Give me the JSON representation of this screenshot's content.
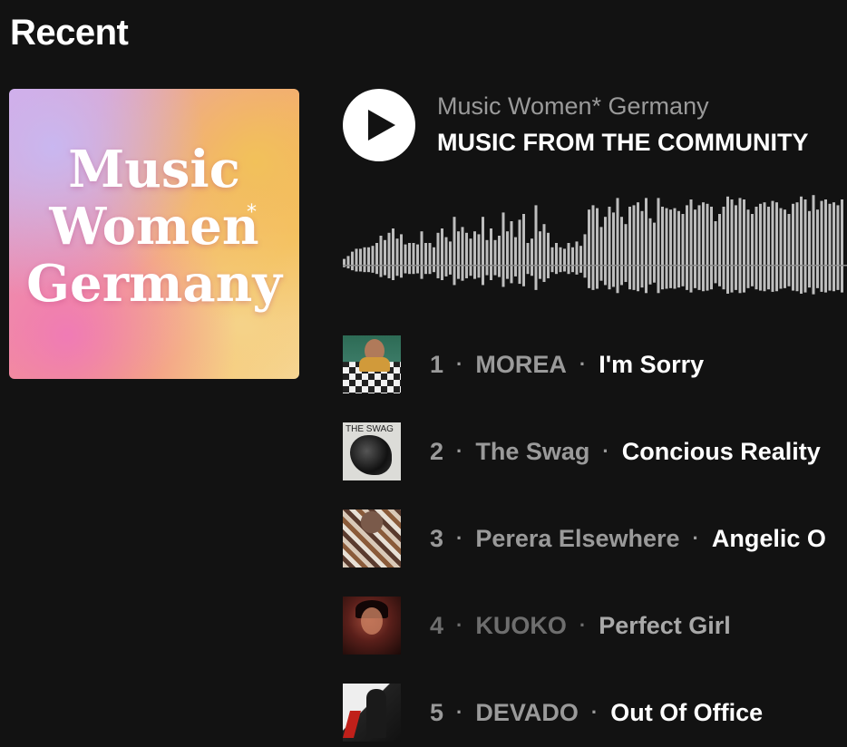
{
  "section": {
    "heading": "Recent"
  },
  "cover": {
    "line1": "Music",
    "line2": "Women",
    "line3": "Germany",
    "asterisk": "*"
  },
  "player": {
    "channel": "Music Women* Germany",
    "playlist_title": "MUSIC FROM THE COMMUNITY",
    "play_icon": "play-icon"
  },
  "waveform": {
    "bar_color": "#bdbdbd",
    "levels": [
      0.08,
      0.12,
      0.18,
      0.22,
      0.22,
      0.24,
      0.24,
      0.26,
      0.3,
      0.4,
      0.34,
      0.44,
      0.5,
      0.36,
      0.42,
      0.28,
      0.3,
      0.3,
      0.28,
      0.46,
      0.3,
      0.3,
      0.24,
      0.44,
      0.5,
      0.38,
      0.32,
      0.66,
      0.46,
      0.52,
      0.44,
      0.36,
      0.46,
      0.42,
      0.66,
      0.34,
      0.5,
      0.34,
      0.4,
      0.72,
      0.46,
      0.6,
      0.38,
      0.62,
      0.7,
      0.3,
      0.36,
      0.82,
      0.46,
      0.56,
      0.44,
      0.24,
      0.3,
      0.24,
      0.22,
      0.3,
      0.24,
      0.32,
      0.26,
      0.42,
      0.76,
      0.82,
      0.78,
      0.52,
      0.66,
      0.8,
      0.72,
      0.92,
      0.66,
      0.56,
      0.8,
      0.82,
      0.86,
      0.74,
      0.92,
      0.64,
      0.58,
      0.92,
      0.8,
      0.78,
      0.76,
      0.78,
      0.74,
      0.7,
      0.82,
      0.9,
      0.76,
      0.82,
      0.86,
      0.84,
      0.8,
      0.6,
      0.7,
      0.8,
      0.94,
      0.9,
      0.82,
      0.92,
      0.9,
      0.76,
      0.7,
      0.8,
      0.84,
      0.86,
      0.8,
      0.88,
      0.86,
      0.78,
      0.76,
      0.7,
      0.84,
      0.86,
      0.94,
      0.9,
      0.74,
      0.96,
      0.76,
      0.88,
      0.9,
      0.84,
      0.86,
      0.82,
      0.9
    ],
    "playhead_color": "#8a8a8a"
  },
  "tracks": [
    {
      "number": "1",
      "artist": "MOREA",
      "title": "I'm Sorry",
      "separator": "·",
      "thumb": "t1",
      "dim": false
    },
    {
      "number": "2",
      "artist": "The Swag",
      "title": "Concious Reality",
      "separator": "·",
      "thumb": "t2",
      "dim": false,
      "thumb_label": "THE SWAG"
    },
    {
      "number": "3",
      "artist": "Perera Elsewhere",
      "title": "Angelic O",
      "separator": "·",
      "thumb": "t3",
      "dim": false
    },
    {
      "number": "4",
      "artist": "KUOKO",
      "title": "Perfect Girl",
      "separator": "·",
      "thumb": "t4",
      "dim": true
    },
    {
      "number": "5",
      "artist": "DEVADO",
      "title": "Out Of Office",
      "separator": "·",
      "thumb": "t5",
      "dim": false
    }
  ]
}
